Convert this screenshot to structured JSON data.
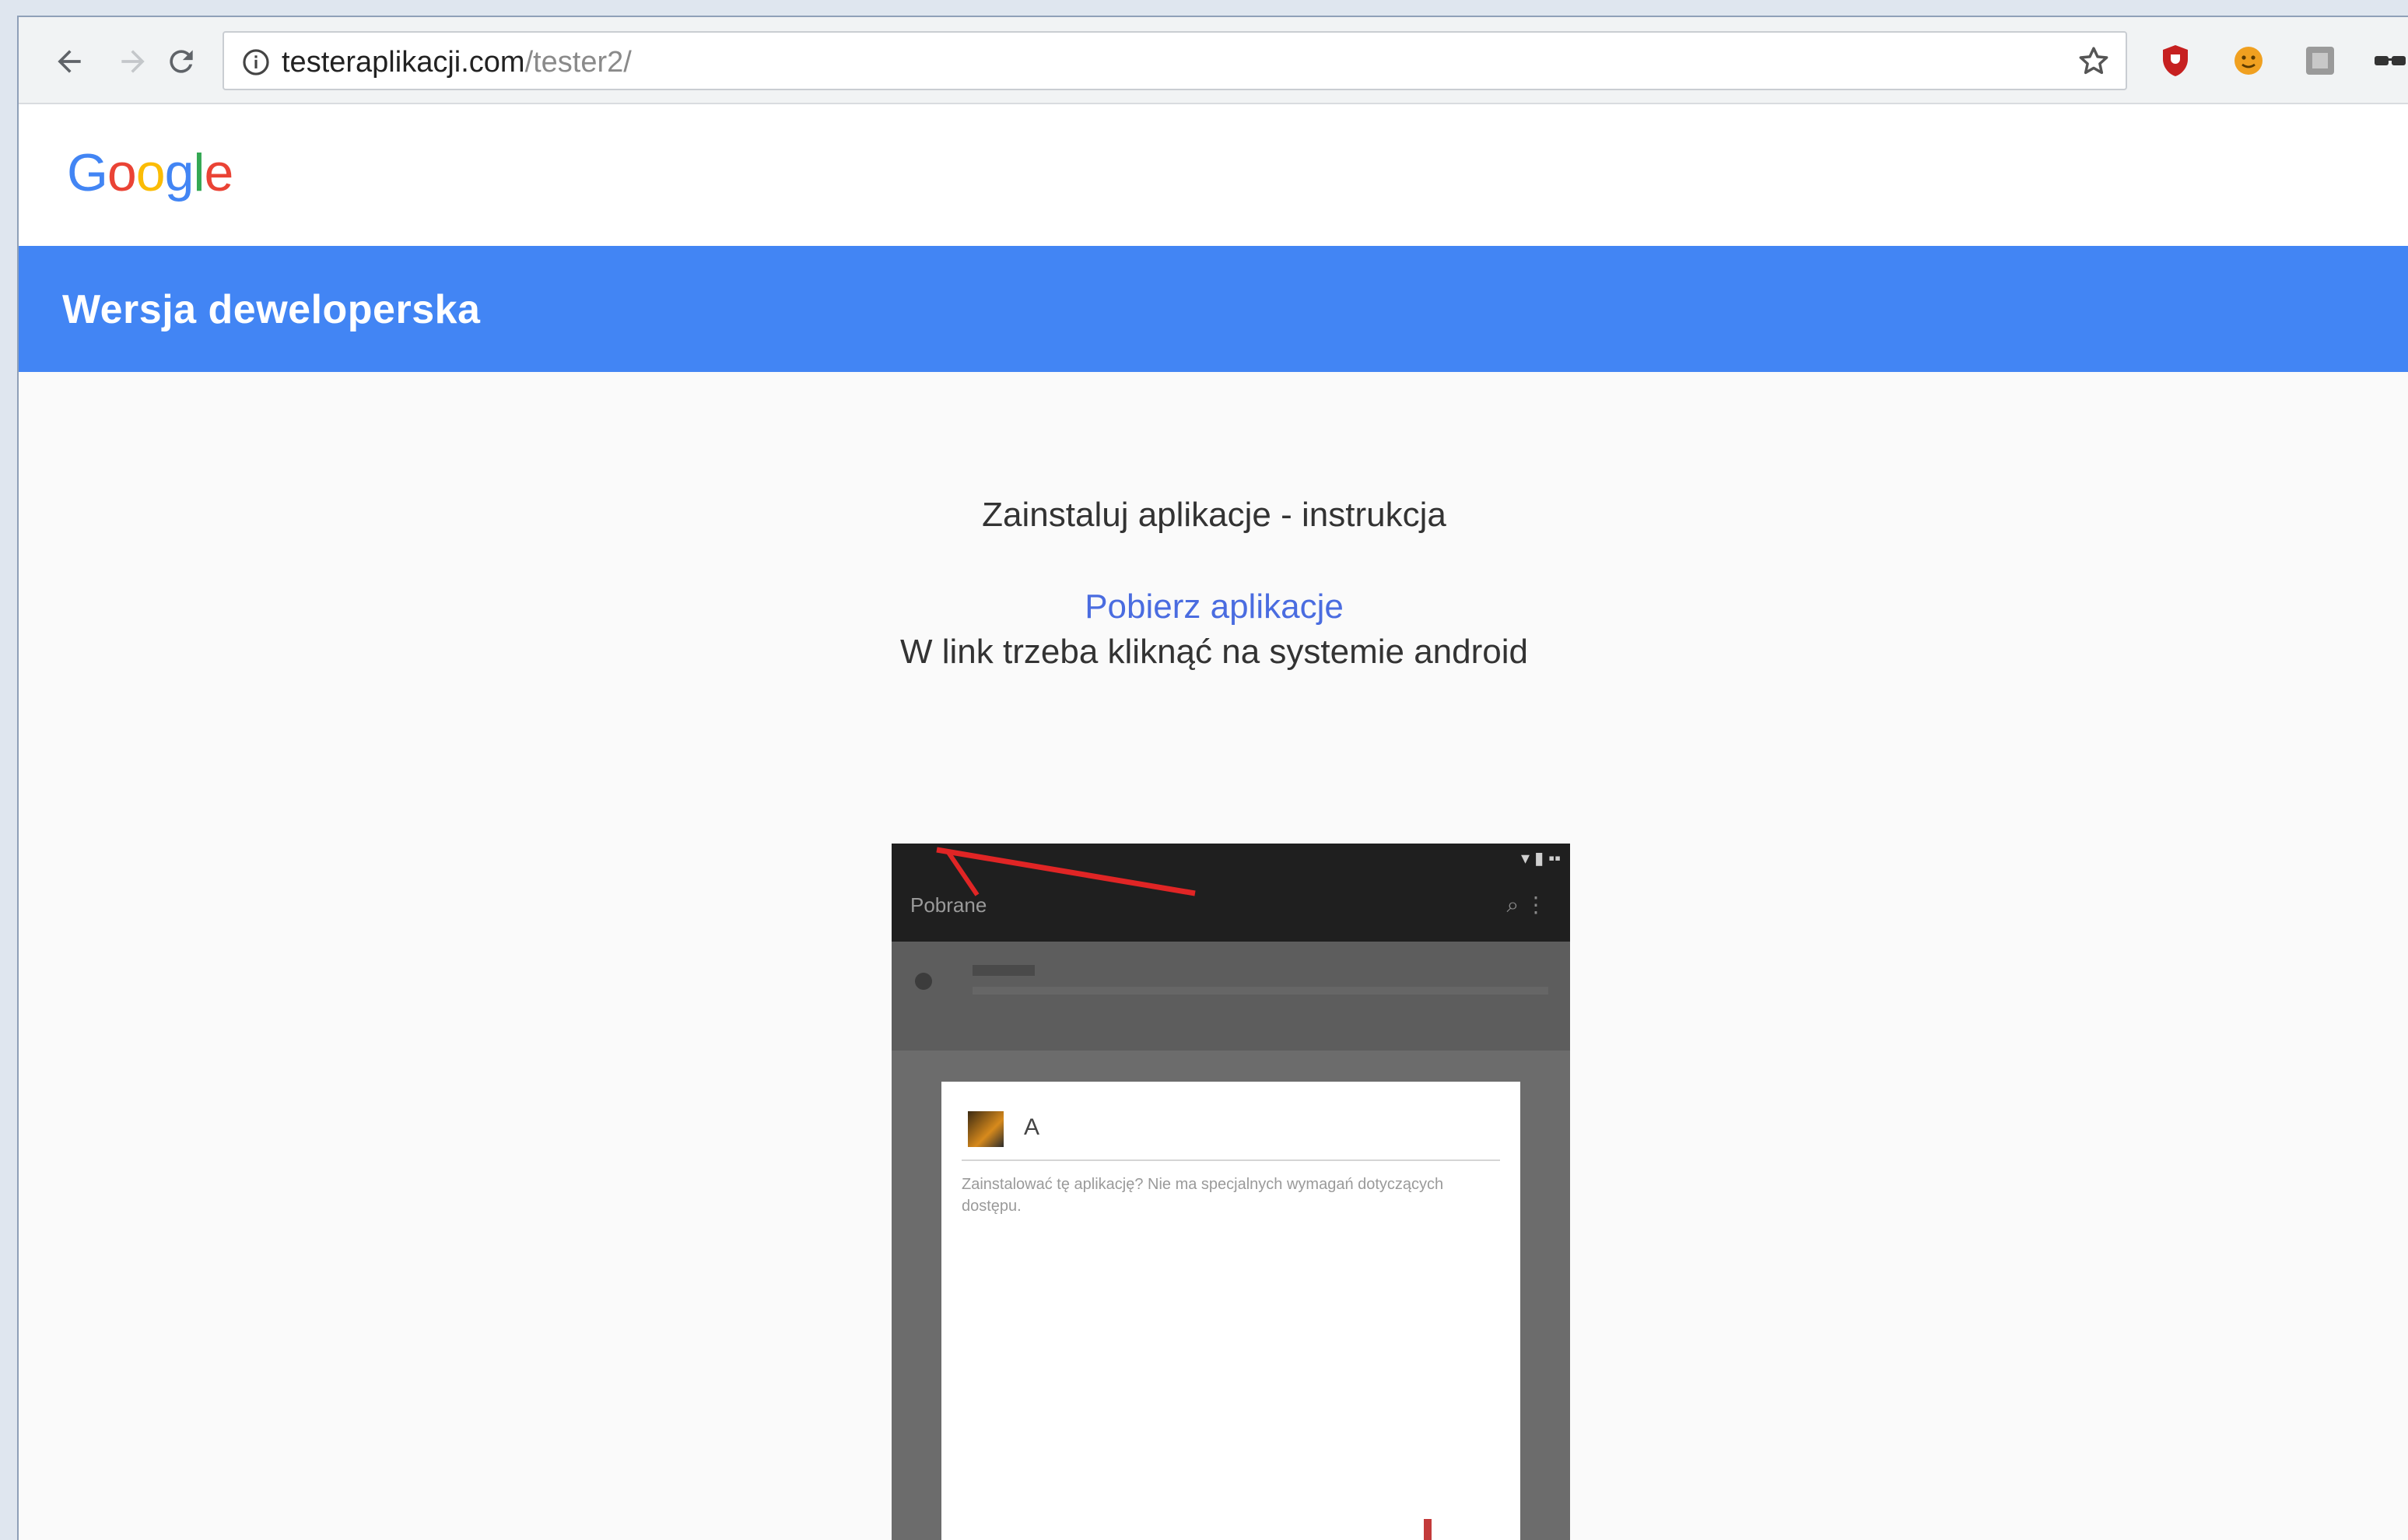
{
  "browser": {
    "url_host": "testeraplikacji.com",
    "url_path": "/tester2/",
    "back_icon": "arrow-left-icon",
    "forward_icon": "arrow-right-icon",
    "reload_icon": "reload-icon",
    "site_info_icon": "info-circle-icon",
    "bookmark_icon": "star-icon",
    "extensions": [
      "shield-extension-icon",
      "face-extension-icon",
      "puzzle-extension-icon",
      "glasses-extension-icon"
    ]
  },
  "page": {
    "logo": {
      "letters": [
        "G",
        "o",
        "o",
        "g",
        "l",
        "e"
      ],
      "colors": [
        "#4285f4",
        "#ea4335",
        "#fbbc05",
        "#4285f4",
        "#34a853",
        "#ea4335"
      ]
    },
    "header_title": "Wersja deweloperska",
    "accent_color": "#4285f4",
    "install_instruction": "Zainstaluj aplikacje - instrukcja",
    "download_link": "Pobierz aplikacje",
    "link_note": "W link trzeba kliknąć na systemie android",
    "screenshot": {
      "appbar_title": "Pobrane",
      "dialog_title": "A",
      "dialog_text": "Zainstalować tę aplikację? Nie ma specjalnych wymagań dotyczących dostępu."
    }
  }
}
